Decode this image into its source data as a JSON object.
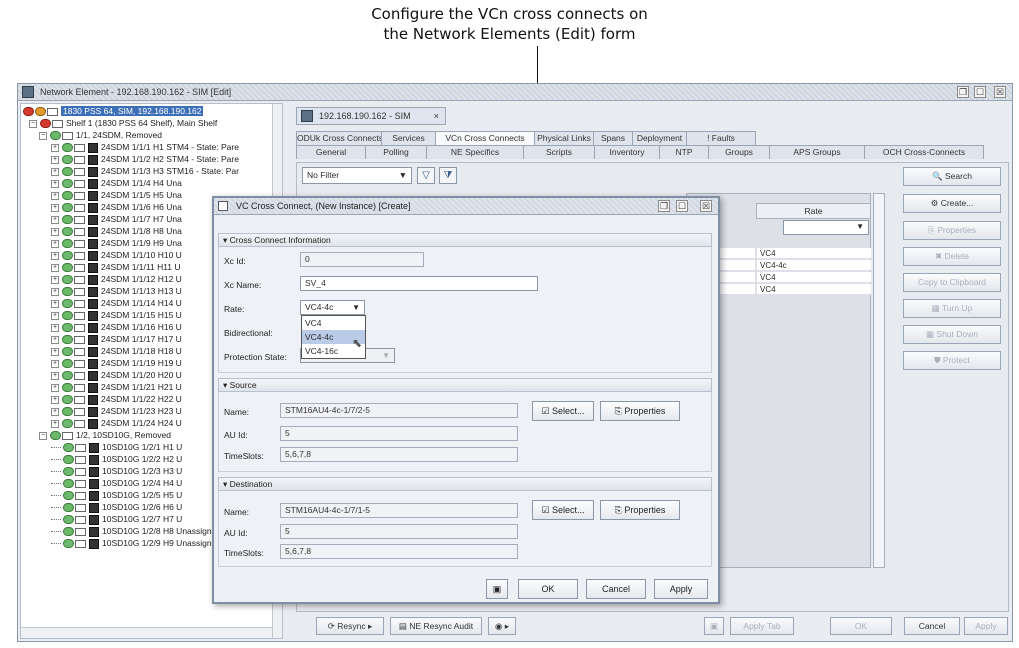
{
  "caption": {
    "line1": "Configure the VCn cross connects on",
    "line2": "the Network Elements (Edit) form"
  },
  "window": {
    "title": "Network Element - 192.168.190.162 - SIM [Edit]",
    "controls": [
      "❐",
      "☐",
      "☒"
    ]
  },
  "tree": {
    "root": "1830 PSS 64, SIM, 192.168.190.162",
    "shelf": "Shelf 1 (1830 PSS 64 Shelf), Main Shelf",
    "card1": "1/1, 24SDM, Removed",
    "ports1": [
      "24SDM 1/1/1 H1 STM4 - State: Pare",
      "24SDM 1/1/2 H2 STM4 - State: Pare",
      "24SDM 1/1/3 H3 STM16 - State: Par",
      "24SDM 1/1/4 H4 Una",
      "24SDM 1/1/5 H5 Una",
      "24SDM 1/1/6 H6 Una",
      "24SDM 1/1/7 H7 Una",
      "24SDM 1/1/8 H8 Una",
      "24SDM 1/1/9 H9 Una",
      "24SDM 1/1/10 H10 U",
      "24SDM 1/1/11 H11 U",
      "24SDM 1/1/12 H12 U",
      "24SDM 1/1/13 H13 U",
      "24SDM 1/1/14 H14 U",
      "24SDM 1/1/15 H15 U",
      "24SDM 1/1/16 H16 U",
      "24SDM 1/1/17 H17 U",
      "24SDM 1/1/18 H18 U",
      "24SDM 1/1/19 H19 U",
      "24SDM 1/1/20 H20 U",
      "24SDM 1/1/21 H21 U",
      "24SDM 1/1/22 H22 U",
      "24SDM 1/1/23 H23 U",
      "24SDM 1/1/24 H24 U"
    ],
    "card2": "1/2, 10SD10G, Removed",
    "ports2": [
      "10SD10G 1/2/1 H1 U",
      "10SD10G 1/2/2 H2 U",
      "10SD10G 1/2/3 H3 U",
      "10SD10G 1/2/4 H4 U",
      "10SD10G 1/2/5 H5 U",
      "10SD10G 1/2/6 H6 U",
      "10SD10G 1/2/7 H7 U",
      "10SD10G 1/2/8 H8 Unassigned - St",
      "10SD10G 1/2/9 H9 Unassigned - St"
    ]
  },
  "doc_tab": {
    "label": "192.168.190.162 - SIM"
  },
  "tabs_row1": [
    "ODUk Cross Connects",
    "Services",
    "VCn Cross Connects",
    "Physical Links",
    "Spans",
    "Deployment",
    "! Faults"
  ],
  "tabs_row2": [
    "General",
    "Polling",
    "NE Specifics",
    "Scripts",
    "Inventory",
    "NTP",
    "Groups",
    "APS Groups",
    "OCH Cross-Connects"
  ],
  "filter": {
    "value": "No Filter"
  },
  "grid": {
    "header": "Rate",
    "rows": [
      {
        "c1": "",
        "c2": "VC4"
      },
      {
        "c1": "",
        "c2": "VC4-4c"
      },
      {
        "c1": "",
        "c2": "VC4"
      },
      {
        "c1": "1--ST...",
        "c2": "VC4"
      }
    ]
  },
  "side_buttons": [
    "Search",
    "Create...",
    "Properties",
    "Delete",
    "Copy to Clipboard",
    "Turn Up",
    "Shut Down",
    "Protect"
  ],
  "bottom_bar": {
    "resync": "Resync",
    "ne_resync_audit": "NE Resync Audit",
    "apply_tab": "Apply Tab",
    "ok": "OK",
    "cancel": "Cancel",
    "apply": "Apply"
  },
  "dialog": {
    "title": "VC Cross Connect, (New Instance) [Create]",
    "section_info": "Cross Connect Information",
    "xc_id_label": "Xc Id:",
    "xc_id": "0",
    "xc_name_label": "Xc Name:",
    "xc_name": "SV_4",
    "rate_label": "Rate:",
    "rate_value": "VC4-4c",
    "rate_options": [
      "VC4",
      "VC4-4c",
      "VC4-16c"
    ],
    "bidirectional_label": "Bidirectional:",
    "protection_label": "Protection State:",
    "section_source": "Source",
    "section_destination": "Destination",
    "name_label": "Name:",
    "au_label": "AU Id:",
    "timeslots_label": "TimeSlots:",
    "source": {
      "name": "STM16AU4-4c-1/7/2-5",
      "au_id": "5",
      "timeslots": "5,6,7,8"
    },
    "destination": {
      "name": "STM16AU4-4c-1/7/1-5",
      "au_id": "5",
      "timeslots": "5,6,7,8"
    },
    "select_label": "Select...",
    "properties_label": "Properties",
    "ok": "OK",
    "cancel": "Cancel",
    "apply": "Apply"
  }
}
